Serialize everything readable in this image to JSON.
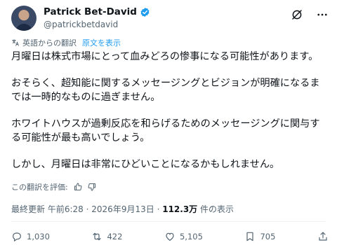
{
  "author": {
    "name": "Patrick Bet-David",
    "handle": "@patrickbetdavid"
  },
  "translation": {
    "note": "英語からの翻訳",
    "show_original": "原文を表示"
  },
  "tweet": {
    "paragraphs": [
      "月曜日は株式市場にとって血みどろの惨事になる可能性があります。",
      "おそらく、超知能に関するメッセージングとビジョンが明確になるまでは一時的なものに過ぎません。",
      "ホワイトハウスが過剰反応を和らげるためのメッセージングに関与する可能性が最も高いでしょう。",
      "しかし、月曜日は非常にひどいことになるかもしれません。"
    ]
  },
  "rate": {
    "label": "この翻訳を評価:"
  },
  "meta": {
    "prefix": "最終更新",
    "time": "午前6:28",
    "sep1": "·",
    "date": "2026年9月13日",
    "sep2": "·",
    "views": "112.3万",
    "views_suffix": "件の表示"
  },
  "actions": {
    "replies": "1,030",
    "reposts": "422",
    "likes": "5,105",
    "bookmarks": "705"
  },
  "colors": {
    "accent": "#1d9bf0",
    "muted": "#536471",
    "text": "#0f1419"
  }
}
